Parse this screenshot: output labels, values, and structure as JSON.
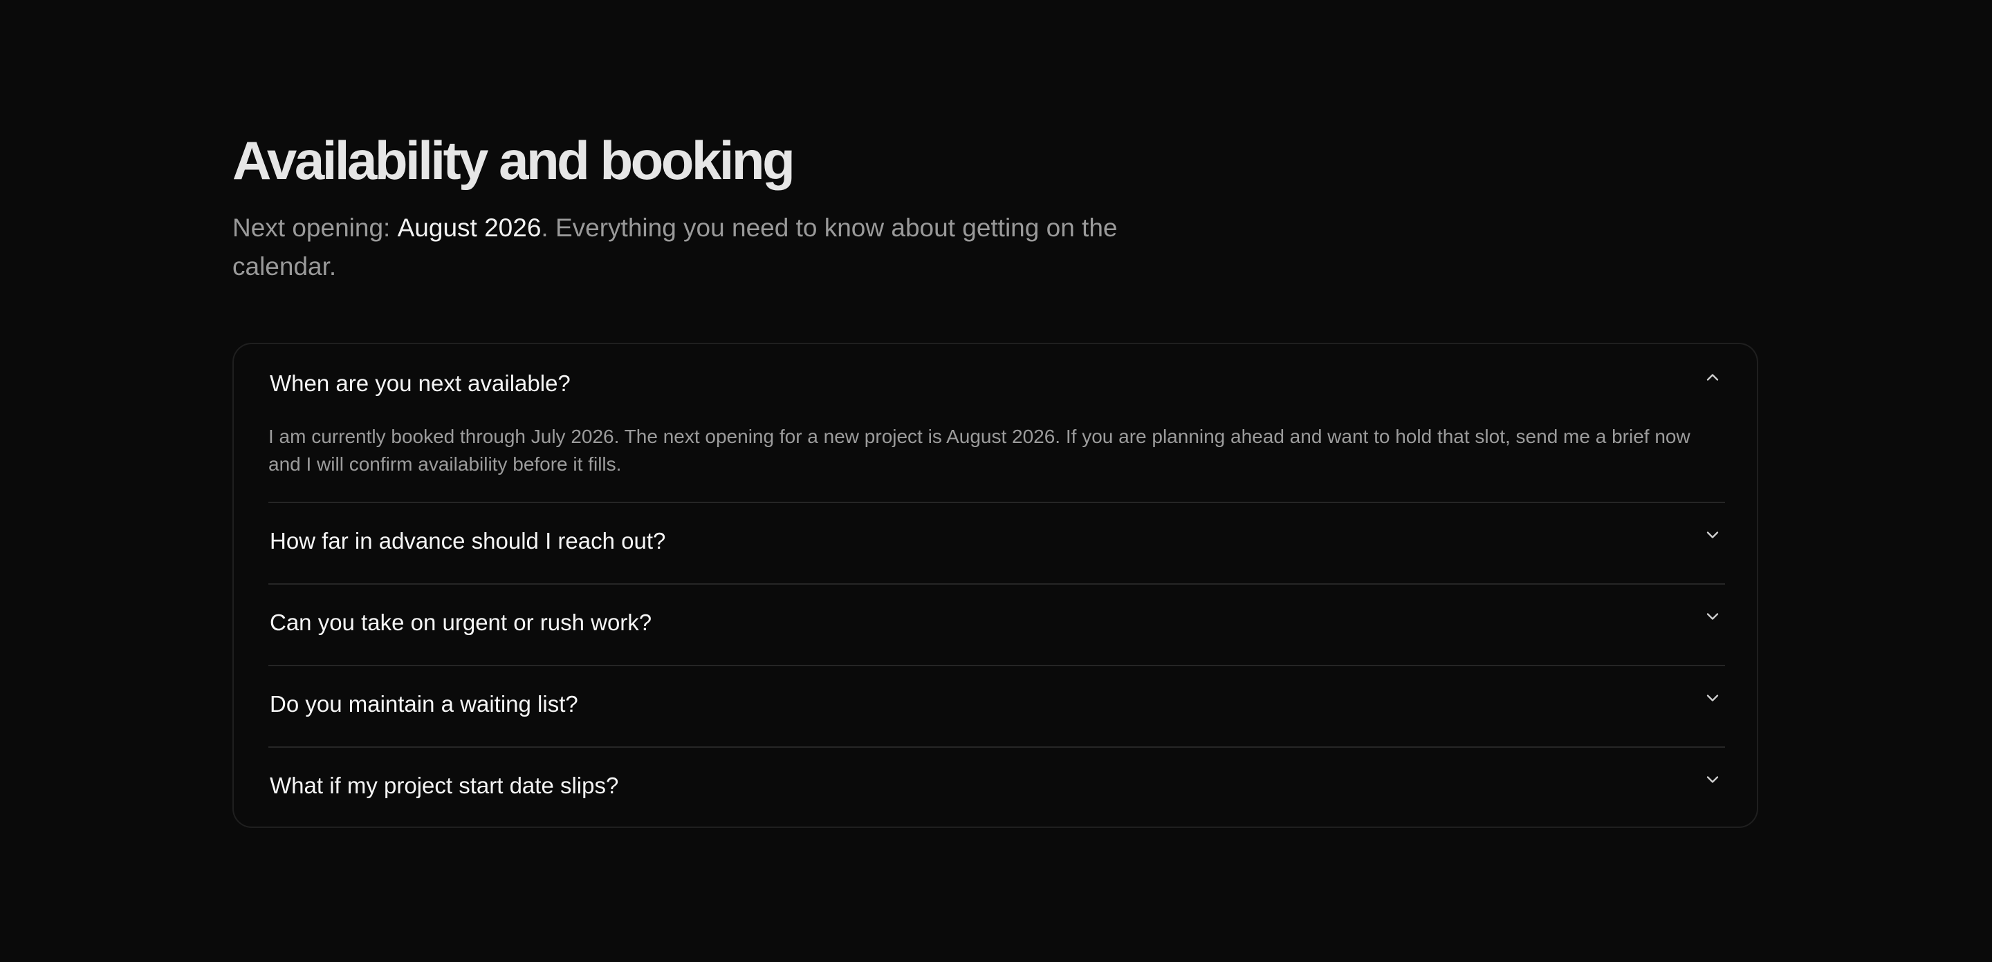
{
  "header": {
    "title": "Availability and booking",
    "subtitle_prefix": "Next opening: ",
    "subtitle_highlight": "August 2026",
    "subtitle_suffix": ". Everything you need to know about getting on the calendar."
  },
  "faq": {
    "items": [
      {
        "question": "When are you next available?",
        "expanded": true,
        "icon": "chevron-up-icon",
        "answer": "I am currently booked through July 2026. The next opening for a new project is August 2026. If you are planning ahead and want to hold that slot, send me a brief now and I will confirm availability before it fills."
      },
      {
        "question": "How far in advance should I reach out?",
        "expanded": false,
        "icon": "chevron-down-icon"
      },
      {
        "question": "Can you take on urgent or rush work?",
        "expanded": false,
        "icon": "chevron-down-icon"
      },
      {
        "question": "Do you maintain a waiting list?",
        "expanded": false,
        "icon": "chevron-down-icon"
      },
      {
        "question": "What if my project start date slips?",
        "expanded": false,
        "icon": "chevron-down-icon"
      }
    ]
  },
  "colors": {
    "background": "#0a0a0a",
    "title": "#e6e6e6",
    "muted_text": "#9a9a9a",
    "highlight_text": "#f2f2f2",
    "border": "#1f1f1f",
    "divider": "#262626"
  }
}
